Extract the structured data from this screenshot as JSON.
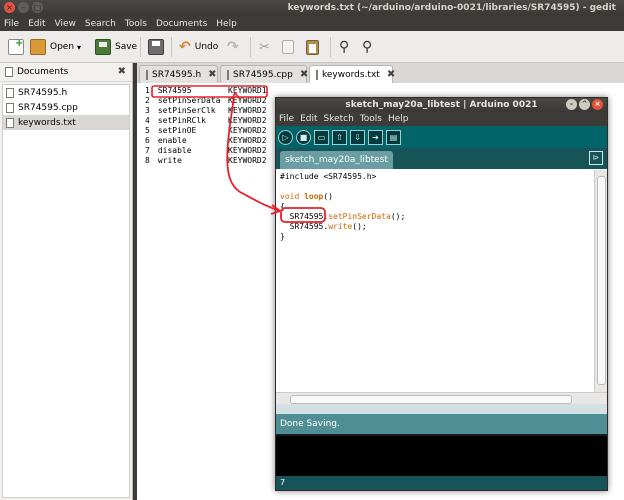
{
  "window": {
    "title": "keywords.txt (~/arduino/arduino-0021/libraries/SR74595) - gedit"
  },
  "menu": [
    "File",
    "Edit",
    "View",
    "Search",
    "Tools",
    "Documents",
    "Help"
  ],
  "toolbar": {
    "open_label": "Open",
    "save_label": "Save",
    "undo_label": "Undo"
  },
  "side_panel": {
    "title": "Documents",
    "files": [
      "SR74595.h",
      "SR74595.cpp",
      "keywords.txt"
    ],
    "selected": "keywords.txt"
  },
  "tabs": [
    {
      "label": "SR74595.h"
    },
    {
      "label": "SR74595.cpp"
    },
    {
      "label": "keywords.txt"
    }
  ],
  "editor": {
    "lines": [
      {
        "num": "1",
        "word": "SR74595",
        "kw": "KEYWORD1"
      },
      {
        "num": "2",
        "word": "setPinSerData",
        "kw": "KEYWORD2"
      },
      {
        "num": "3",
        "word": "setPinSerClk",
        "kw": "KEYWORD2"
      },
      {
        "num": "4",
        "word": "setPinRClk",
        "kw": "KEYWORD2"
      },
      {
        "num": "5",
        "word": "setPinOE",
        "kw": "KEYWORD2"
      },
      {
        "num": "6",
        "word": "enable",
        "kw": "KEYWORD2"
      },
      {
        "num": "7",
        "word": "disable",
        "kw": "KEYWORD2"
      },
      {
        "num": "8",
        "word": "write",
        "kw": "KEYWORD2"
      }
    ]
  },
  "arduino": {
    "title": "sketch_may20a_libtest | Arduino 0021",
    "menu": [
      "File",
      "Edit",
      "Sketch",
      "Tools",
      "Help"
    ],
    "tab_label": "sketch_may20a_libtest",
    "code": {
      "l1": "#include <SR74595.h>",
      "l3a": "void",
      "l3b": "loop",
      "l3c": "()",
      "l4": "{",
      "l5a": "SR74595",
      "l5b": ".",
      "l5c": "setPinSerData",
      "l5d": "();",
      "l6a": "SR74595",
      "l6b": ".",
      "l6c": "write",
      "l6d": "();",
      "l7": "}"
    },
    "status": "Done Saving.",
    "line_number": "7"
  },
  "colors": {
    "annotation": "#e8202a",
    "arduino_teal": "#006468",
    "arduino_keyword": "#cc6600"
  }
}
